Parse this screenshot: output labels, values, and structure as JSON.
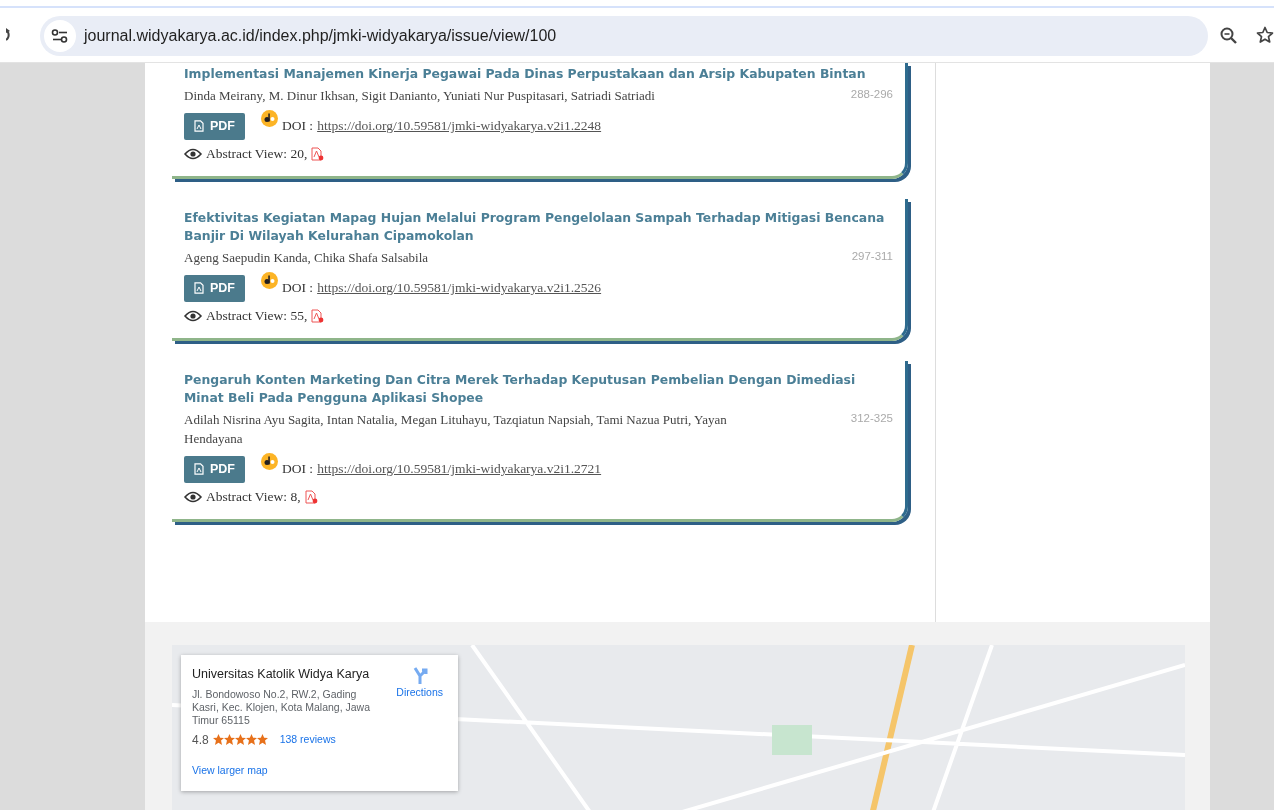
{
  "browser": {
    "url": "journal.widyakarya.ac.id/index.php/jmki-widyakarya/issue/view/100"
  },
  "articles": [
    {
      "title": "Implementasi Manajemen Kinerja Pegawai Pada Dinas Perpustakaan dan Arsip Kabupaten Bintan",
      "authors": "Dinda Meirany, M. Dinur Ikhsan, Sigit Danianto, Yuniati Nur Puspitasari, Satriadi Satriadi",
      "pages": "288-296",
      "button": "PDF",
      "doi_label": "DOI :",
      "doi": "https://doi.org/10.59581/jmki-widyakarya.v2i1.2248",
      "views": "Abstract View: 20,"
    },
    {
      "title": "Efektivitas Kegiatan Mapag Hujan Melalui Program Pengelolaan Sampah Terhadap Mitigasi Bencana Banjir Di Wilayah Kelurahan Cipamokolan",
      "authors": "Ageng Saepudin Kanda, Chika Shafa Salsabila",
      "pages": "297-311",
      "button": "PDF",
      "doi_label": "DOI :",
      "doi": "https://doi.org/10.59581/jmki-widyakarya.v2i1.2526",
      "views": "Abstract View: 55,"
    },
    {
      "title": "Pengaruh Konten Marketing Dan Citra Merek Terhadap Keputusan Pembelian Dengan Dimediasi Minat Beli Pada Pengguna Aplikasi Shopee",
      "authors": "Adilah Nisrina Ayu Sagita, Intan Natalia, Megan Lituhayu, Tazqiatun Napsiah, Tami Nazua Putri, Yayan Hendayana",
      "pages": "312-325",
      "button": "PDF",
      "doi_label": "DOI :",
      "doi": "https://doi.org/10.59581/jmki-widyakarya.v2i1.2721",
      "views": "Abstract View: 8,"
    }
  ],
  "map_card": {
    "name": "Universitas Katolik Widya Karya",
    "address": "Jl. Bondowoso No.2, RW.2, Gading Kasri, Kec. Klojen, Kota Malang, Jawa Timur 65115",
    "directions": "Directions",
    "rating": "4.8",
    "stars": 5,
    "reviews": "138 reviews",
    "link": "View larger map"
  }
}
